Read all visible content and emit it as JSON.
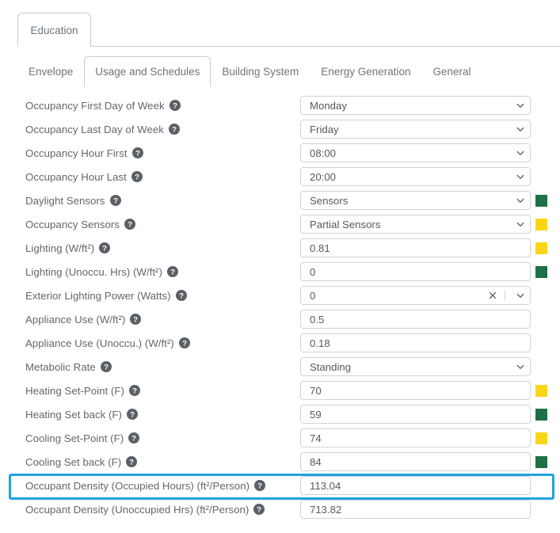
{
  "outer_tabs": [
    {
      "label": "Education",
      "active": true
    }
  ],
  "inner_tabs": [
    {
      "label": "Envelope",
      "active": false
    },
    {
      "label": "Usage and Schedules",
      "active": true
    },
    {
      "label": "Building System",
      "active": false
    },
    {
      "label": "Energy Generation",
      "active": false
    },
    {
      "label": "General",
      "active": false
    }
  ],
  "icons": {
    "help": "help-circle-icon",
    "chevron": "chevron-down-icon",
    "clear": "close-x-icon"
  },
  "colors": {
    "green_swatch": "#1e7045",
    "yellow_swatch": "#fbd518",
    "highlight": "#1fa2dd",
    "border": "#ced4da",
    "text": "#62686d"
  },
  "rows": [
    {
      "label": "Occupancy First Day of Week",
      "value": "Monday",
      "type": "select",
      "swatch": null
    },
    {
      "label": "Occupancy Last Day of Week",
      "value": "Friday",
      "type": "select",
      "swatch": null
    },
    {
      "label": "Occupancy Hour First",
      "value": "08:00",
      "type": "select",
      "swatch": null
    },
    {
      "label": "Occupancy Hour Last",
      "value": "20:00",
      "type": "select",
      "swatch": null
    },
    {
      "label": "Daylight Sensors",
      "value": "Sensors",
      "type": "select",
      "swatch": "green"
    },
    {
      "label": "Occupancy Sensors",
      "value": "Partial Sensors",
      "type": "select",
      "swatch": "yellow"
    },
    {
      "label": "Lighting (W/ft²)",
      "value": "0.81",
      "type": "text",
      "swatch": "yellow"
    },
    {
      "label": "Lighting (Unoccu. Hrs) (W/ft²)",
      "value": "0",
      "type": "text",
      "swatch": "green"
    },
    {
      "label": "Exterior Lighting Power (Watts)",
      "value": "0",
      "type": "clearable-select",
      "swatch": null
    },
    {
      "label": "Appliance Use (W/ft²)",
      "value": "0.5",
      "type": "text",
      "swatch": null
    },
    {
      "label": "Appliance Use (Unoccu.) (W/ft²)",
      "value": "0.18",
      "type": "text",
      "swatch": null
    },
    {
      "label": "Metabolic Rate",
      "value": "Standing",
      "type": "select",
      "swatch": null
    },
    {
      "label": "Heating Set-Point (F)",
      "value": "70",
      "type": "text",
      "swatch": "yellow"
    },
    {
      "label": "Heating Set back (F)",
      "value": "59",
      "type": "text",
      "swatch": "green"
    },
    {
      "label": "Cooling Set-Point (F)",
      "value": "74",
      "type": "text",
      "swatch": "yellow"
    },
    {
      "label": "Cooling Set back (F)",
      "value": "84",
      "type": "text",
      "swatch": "green"
    },
    {
      "label": "Occupant Density (Occupied Hours) (ft²/Person)",
      "value": "113.04",
      "type": "text",
      "swatch": null,
      "highlighted": true
    },
    {
      "label": "Occupant Density (Unoccupied Hrs) (ft²/Person)",
      "value": "713.82",
      "type": "text",
      "swatch": null
    }
  ]
}
